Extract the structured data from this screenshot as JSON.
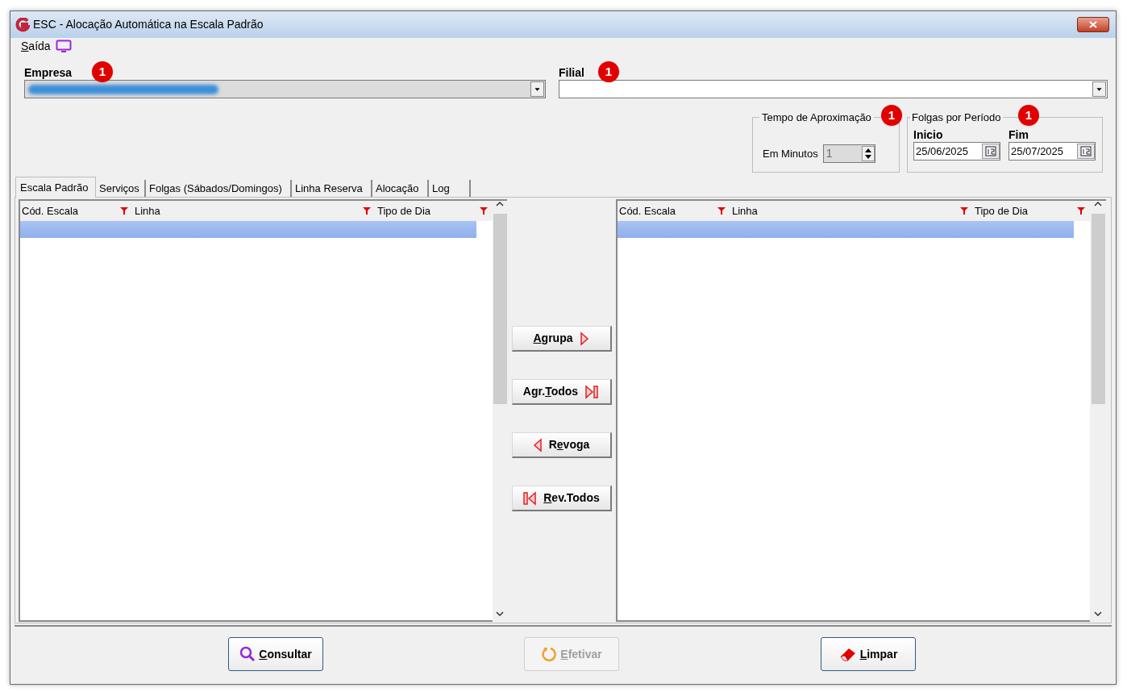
{
  "window": {
    "title": "ESC - Alocação Automática na Escala Padrão"
  },
  "menu": [
    {
      "label": "Saída"
    }
  ],
  "empresa": {
    "label": "Empresa",
    "badge": "1"
  },
  "filial": {
    "label": "Filial",
    "badge": "1"
  },
  "tempo": {
    "title": "Tempo de Aproximação",
    "badge": "1",
    "field_label": "Em Minutos",
    "value": "1"
  },
  "folgas": {
    "title": "Folgas por Período",
    "badge": "1",
    "inicio_label": "Inicio",
    "inicio": "25/06/2025",
    "fim_label": "Fim",
    "fim": "25/07/2025"
  },
  "tabs": [
    {
      "label": "Escala Padrão",
      "selected": true
    },
    {
      "label": "Serviços",
      "selected": false
    },
    {
      "label": "Folgas (Sábados/Domingos)",
      "selected": false
    },
    {
      "label": "Linha Reserva",
      "selected": false
    },
    {
      "label": "Alocação",
      "selected": false
    },
    {
      "label": "Log",
      "selected": false
    }
  ],
  "left_grid": {
    "columns": [
      "Cód. Escala",
      "Linha",
      "Tipo de Dia"
    ]
  },
  "right_grid": {
    "columns": [
      "Cód. Escala",
      "Linha",
      "Tipo de Dia"
    ]
  },
  "transfer_buttons": [
    {
      "label": "Agrupa",
      "kind": "right"
    },
    {
      "label": "Agr.Todos",
      "kind": "right_all"
    },
    {
      "label": "Revoga",
      "kind": "left"
    },
    {
      "label": "Rev.Todos",
      "kind": "left_all"
    }
  ],
  "bottom_buttons": [
    {
      "label": "Consultar",
      "kind": "search",
      "disabled": false
    },
    {
      "label": "Efetivar",
      "kind": "apply",
      "disabled": true
    },
    {
      "label": "Limpar",
      "kind": "clear",
      "disabled": false
    }
  ]
}
